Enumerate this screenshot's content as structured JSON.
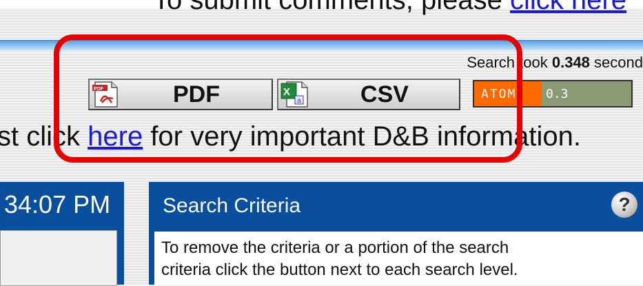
{
  "header": {
    "submit_text": "To submit comments, please",
    "submit_link": "click here"
  },
  "search_info": {
    "prefix": "Search took",
    "seconds": "0.348",
    "suffix": "second"
  },
  "export": {
    "pdf_label": "PDF",
    "pdf_icon": "pdf-file-icon",
    "csv_label": "CSV",
    "csv_icon": "excel-file-icon",
    "atom_label": "ATOM",
    "atom_version": "0.3"
  },
  "notice": {
    "prefix": "st click",
    "link": "here",
    "suffix": "for very important D&B information."
  },
  "time_panel": {
    "time": "34:07 PM"
  },
  "criteria_panel": {
    "title": "Search Criteria",
    "help_icon": "?",
    "body_line1": "To remove the criteria or a portion of the search",
    "body_line2": "criteria click the button next to each search level."
  },
  "colors": {
    "highlight": "#e60000",
    "panel_blue": "#0a4f9e",
    "link_blue": "#1a1ad6",
    "atom_orange": "#ff6a00"
  }
}
